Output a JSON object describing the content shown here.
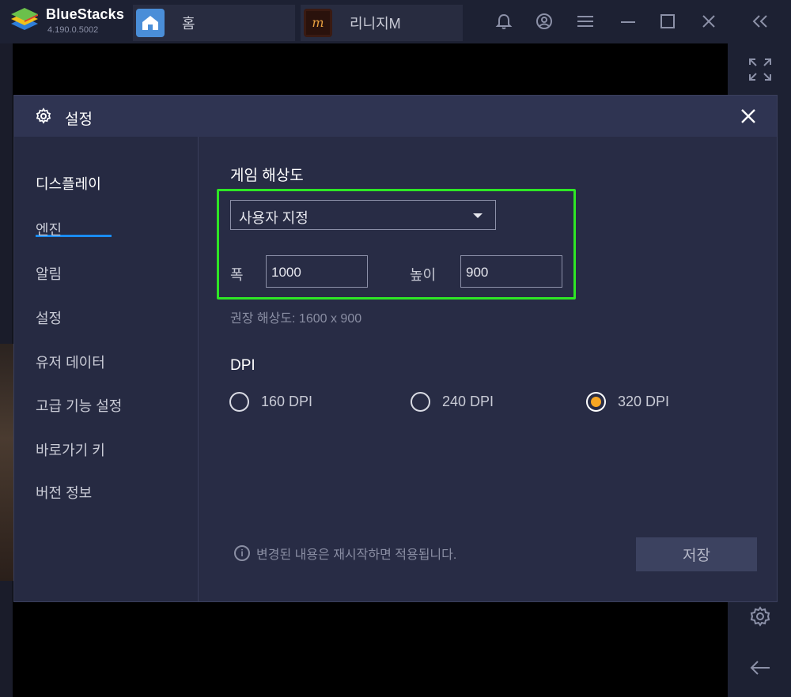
{
  "app": {
    "name": "BlueStacks",
    "version": "4.190.0.5002"
  },
  "tabs": [
    {
      "label": "홈",
      "icon": "home-icon"
    },
    {
      "label": "리니지M",
      "icon": "lineage-m-app-icon"
    }
  ],
  "dialog": {
    "title": "설정",
    "close_icon": "close-icon",
    "nav": [
      {
        "label": "디스플레이",
        "active": true
      },
      {
        "label": "엔진",
        "active": false
      },
      {
        "label": "알림",
        "active": false
      },
      {
        "label": "설정",
        "active": false
      },
      {
        "label": "유저 데이터",
        "active": false
      },
      {
        "label": "고급 기능 설정",
        "active": false
      },
      {
        "label": "바로가기 키",
        "active": false
      },
      {
        "label": "버전 정보",
        "active": false
      }
    ],
    "resolution": {
      "section_title": "게임 해상도",
      "preset": "사용자 지정",
      "width_label": "폭",
      "width_value": "1000",
      "height_label": "높이",
      "height_value": "900",
      "recommended": "권장 해상도: 1600 x 900"
    },
    "dpi": {
      "section_title": "DPI",
      "options": [
        {
          "label": "160 DPI",
          "checked": false
        },
        {
          "label": "240 DPI",
          "checked": false
        },
        {
          "label": "320 DPI",
          "checked": true
        }
      ]
    },
    "notice": "변경된 내용은 재시작하면 적용됩니다.",
    "save_label": "저장"
  },
  "colors": {
    "highlight": "#2ee625",
    "accent_underline": "#1a8bf0",
    "radio_selected": "#f7a623"
  }
}
